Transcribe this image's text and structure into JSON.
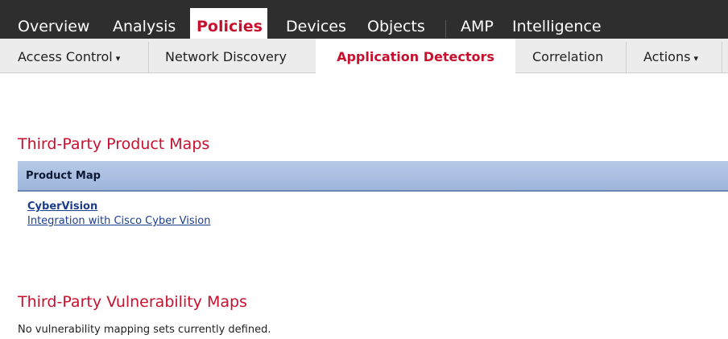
{
  "top_nav": {
    "tabs": [
      "Overview",
      "Analysis",
      "Policies",
      "Devices",
      "Objects",
      "AMP",
      "Intelligence"
    ],
    "active": "Policies"
  },
  "sub_nav": {
    "items": [
      "Access Control",
      "Network Discovery",
      "Application Detectors",
      "Correlation",
      "Actions"
    ],
    "active": "Application Detectors",
    "dropdown_caret": "▾"
  },
  "product_maps": {
    "title": "Third-Party Product Maps",
    "column_header": "Product Map",
    "rows": [
      {
        "name": "CyberVision",
        "description": "Integration with Cisco Cyber Vision"
      }
    ]
  },
  "vulnerability_maps": {
    "title": "Third-Party Vulnerability Maps",
    "empty_message": "No vulnerability mapping sets currently defined."
  },
  "colors": {
    "accent": "#c8102e",
    "nav_bg": "#2e2e2e",
    "subnav_bg": "#ececec",
    "table_header": "#a9bfe2",
    "link": "#1d3d8a"
  }
}
